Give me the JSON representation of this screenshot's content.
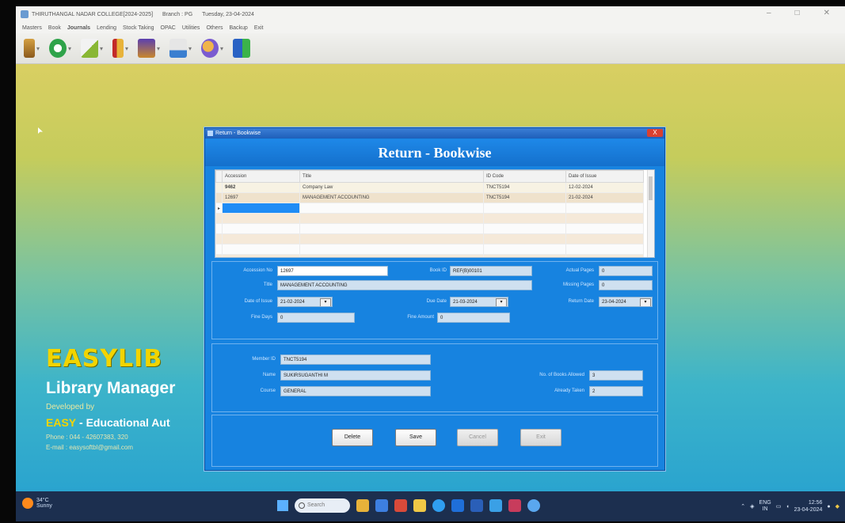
{
  "window": {
    "title": "THIRUTHANGAL NADAR COLLEGE[2024-2025]",
    "branch": "Branch : PG",
    "date": "Tuesday, 23-04-2024"
  },
  "menu": [
    "Masters",
    "Book",
    "Journals",
    "Lending",
    "Stock Taking",
    "OPAC",
    "Utilities",
    "Others",
    "Backup",
    "Exit"
  ],
  "dialog": {
    "title": "Return - Bookwise",
    "header": "Return - Bookwise",
    "close_label": "X"
  },
  "grid": {
    "columns": [
      "Accession",
      "Title",
      "ID Code",
      "Date of Issue"
    ],
    "rows": [
      {
        "accession": "9462",
        "title": "Company Law",
        "id_code": "TNCT5194",
        "date": "12-02-2024"
      },
      {
        "accession": "12697",
        "title": "MANAGEMENT ACCOUNTING",
        "id_code": "TNCT5194",
        "date": "21-02-2024"
      }
    ]
  },
  "book_details": {
    "accession_no_label": "Accession No",
    "accession_no": "12697",
    "book_id_label": "Book ID",
    "book_id": "REF(B)00101",
    "actual_pages_label": "Actual Pages",
    "actual_pages": "0",
    "title_label": "Title",
    "title": "MANAGEMENT ACCOUNTING",
    "missing_pages_label": "Missing Pages",
    "missing_pages": "0",
    "date_of_issue_label": "Date of Issue",
    "date_of_issue": "21-02-2024",
    "due_date_label": "Due Date",
    "due_date": "21-03-2024",
    "return_date_label": "Return Date",
    "return_date": "23-04-2024",
    "fine_days_label": "Fine Days",
    "fine_days": "0",
    "fine_amount_label": "Fine Amount",
    "fine_amount": "0"
  },
  "member_details": {
    "member_id_label": "Member ID",
    "member_id": "TNCT5194",
    "name_label": "Name",
    "name": "SUKIRSUGANTHI M",
    "course_label": "Course",
    "course": "GENERAL",
    "books_allowed_label": "No. of Books Allowed",
    "books_allowed": "3",
    "already_taken_label": "Already Taken",
    "already_taken": "2"
  },
  "buttons": {
    "delete": "Delete",
    "save": "Save",
    "cancel": "Cancel",
    "exit": "Exit"
  },
  "branding": {
    "title": "EASYLIB",
    "subtitle": "Library Manager",
    "developed_by": "Developed by",
    "company_prefix": "EASY",
    "company": " - Educational Aut",
    "phone": "Phone : 044 - 42607383, 320",
    "email": "E-mail : easysoftbl@gmail.com"
  },
  "taskbar": {
    "weather_temp": "34°C",
    "weather_desc": "Sunny",
    "search_placeholder": "Search",
    "lang": "ENG",
    "lang_sub": "IN",
    "time": "12:56",
    "date": "23-04-2024"
  },
  "colors": {
    "dialog_bg": "#1783e0",
    "header_bg": "#1470cc",
    "brand_yellow": "#f2d400",
    "taskbar": "#1c2f4f"
  }
}
